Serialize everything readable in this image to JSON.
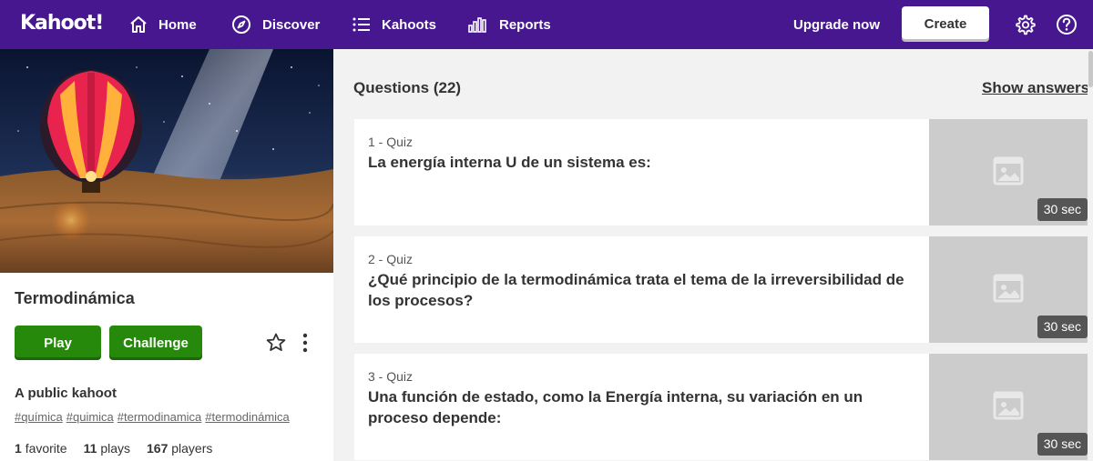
{
  "app": {
    "logo": "Kahoot!"
  },
  "nav": {
    "home": "Home",
    "discover": "Discover",
    "kahoots": "Kahoots",
    "reports": "Reports",
    "upgrade": "Upgrade now",
    "create": "Create"
  },
  "kahoot": {
    "title": "Termodinámica",
    "play": "Play",
    "challenge": "Challenge",
    "visibility": "A public kahoot",
    "tags": [
      "#química",
      "#quimica",
      "#termodinamica",
      "#termodinámica"
    ],
    "stats": {
      "favorites_num": "1",
      "favorites_label": "favorite",
      "plays_num": "11",
      "plays_label": "plays",
      "players_num": "167",
      "players_label": "players"
    }
  },
  "questions": {
    "header": "Questions (22)",
    "show_answers": "Show answers",
    "items": [
      {
        "meta": "1 - Quiz",
        "text": "La energía interna U de un sistema es:",
        "time": "30 sec"
      },
      {
        "meta": "2 - Quiz",
        "text": "¿Qué principio de la termodinámica trata el tema de la irreversibilidad de los procesos?",
        "time": "30 sec"
      },
      {
        "meta": "3 - Quiz",
        "text": "Una función de estado, como la Energía interna, su variación en un proceso depende:",
        "time": "30 sec"
      }
    ]
  },
  "colors": {
    "topbar": "#46178f",
    "green": "#26890c",
    "thumb": "#cccccc"
  }
}
